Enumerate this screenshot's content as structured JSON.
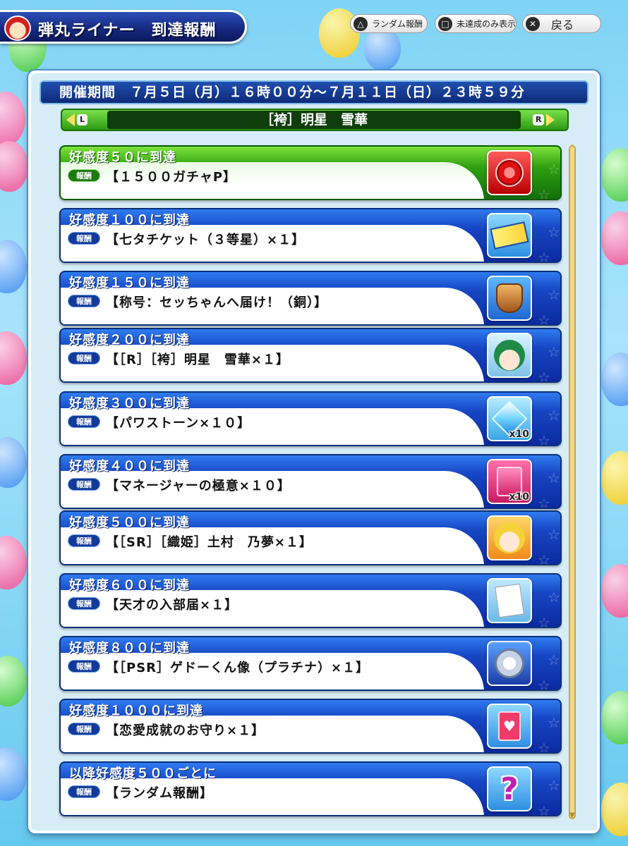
{
  "header": {
    "title": "弾丸ライナー　到達報酬",
    "buttons": [
      {
        "icon": "triangle-button-icon",
        "glyph": "△",
        "label": "ランダム報酬"
      },
      {
        "icon": "square-button-icon",
        "glyph": "□",
        "label": "未達成のみ表示"
      },
      {
        "icon": "cross-button-icon",
        "glyph": "✕",
        "label": "戻る"
      }
    ]
  },
  "period": "開催期間　７月５日（月）１６時００分～７月１１日（日）２３時５９分",
  "character": {
    "left_key": "L",
    "right_key": "R",
    "name": "［袴］明星　雪華"
  },
  "reward_badge_label": "報酬",
  "rewards": [
    {
      "condition": "好感度５０に到達",
      "reward": "【１５００ガチャP】",
      "style": "green",
      "icon": "gacha-point-coin-icon"
    },
    {
      "condition": "好感度１００に到達",
      "reward": "【七タチケット（３等星）×１】",
      "style": "blue",
      "icon": "tanabata-ticket-icon"
    },
    {
      "condition": "好感度１５０に到達",
      "reward": "【称号：セッちゃんへ届け！（銅）】",
      "style": "blue",
      "icon": "bronze-title-badge-icon"
    },
    {
      "condition": "好感度２００に到達",
      "reward": "【［R］［袴］明星　雪華×１】",
      "style": "blue",
      "icon": "character-card-r-icon"
    },
    {
      "condition": "好感度３００に到達",
      "reward": "【パワストーン×１０】",
      "style": "blue",
      "icon": "power-stone-icon",
      "qty": "x10"
    },
    {
      "condition": "好感度４００に到達",
      "reward": "【マネージャーの極意×１０】",
      "style": "blue",
      "icon": "manager-secret-icon",
      "qty": "x10"
    },
    {
      "condition": "好感度５００に到達",
      "reward": "【［SR］［織姫］土村　乃夢×１】",
      "style": "blue",
      "icon": "character-card-sr-icon"
    },
    {
      "condition": "好感度６００に到達",
      "reward": "【天才の入部届×１】",
      "style": "blue",
      "icon": "club-application-form-icon"
    },
    {
      "condition": "好感度８００に到達",
      "reward": "【［PSR］ゲドーくん像（プラチナ）×１】",
      "style": "blue",
      "icon": "statue-card-psr-icon"
    },
    {
      "condition": "好感度１０００に到達",
      "reward": "【恋愛成就のお守り×１】",
      "style": "blue",
      "icon": "love-charm-icon"
    },
    {
      "condition": "以降好感度５００ごとに",
      "reward": "【ランダム報酬】",
      "style": "blue",
      "icon": "question-mark-icon"
    }
  ],
  "colors": {
    "row_blue": "#1746c4",
    "row_green": "#2e9e10",
    "header_navy": "#14277d"
  }
}
